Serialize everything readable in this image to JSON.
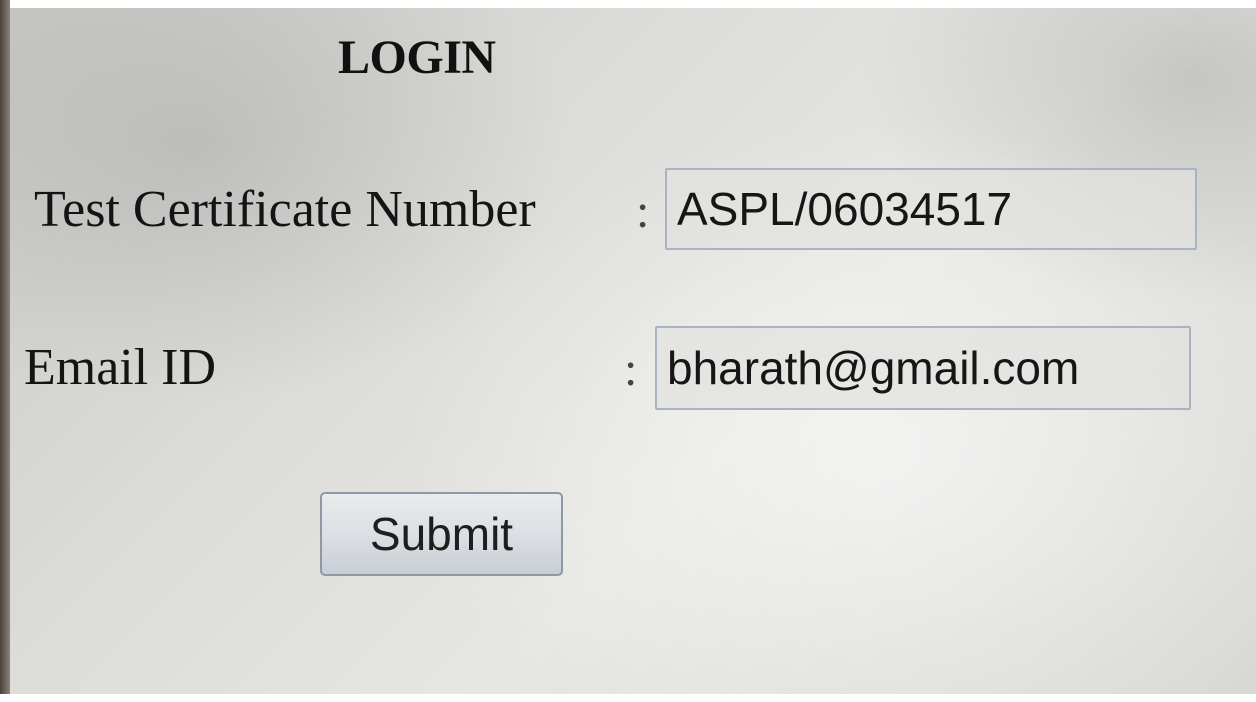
{
  "form": {
    "title": "LOGIN",
    "certificate": {
      "label": "Test Certificate Number",
      "separator": ":",
      "value": "ASPL/06034517"
    },
    "email": {
      "label": "Email ID",
      "separator": ":",
      "value": "bharath@gmail.com"
    },
    "submit_label": "Submit"
  },
  "colors": {
    "background": "#dcdcd9",
    "text": "#141414",
    "field_border": "#a9b4c2",
    "button_border": "#8f99a6"
  }
}
